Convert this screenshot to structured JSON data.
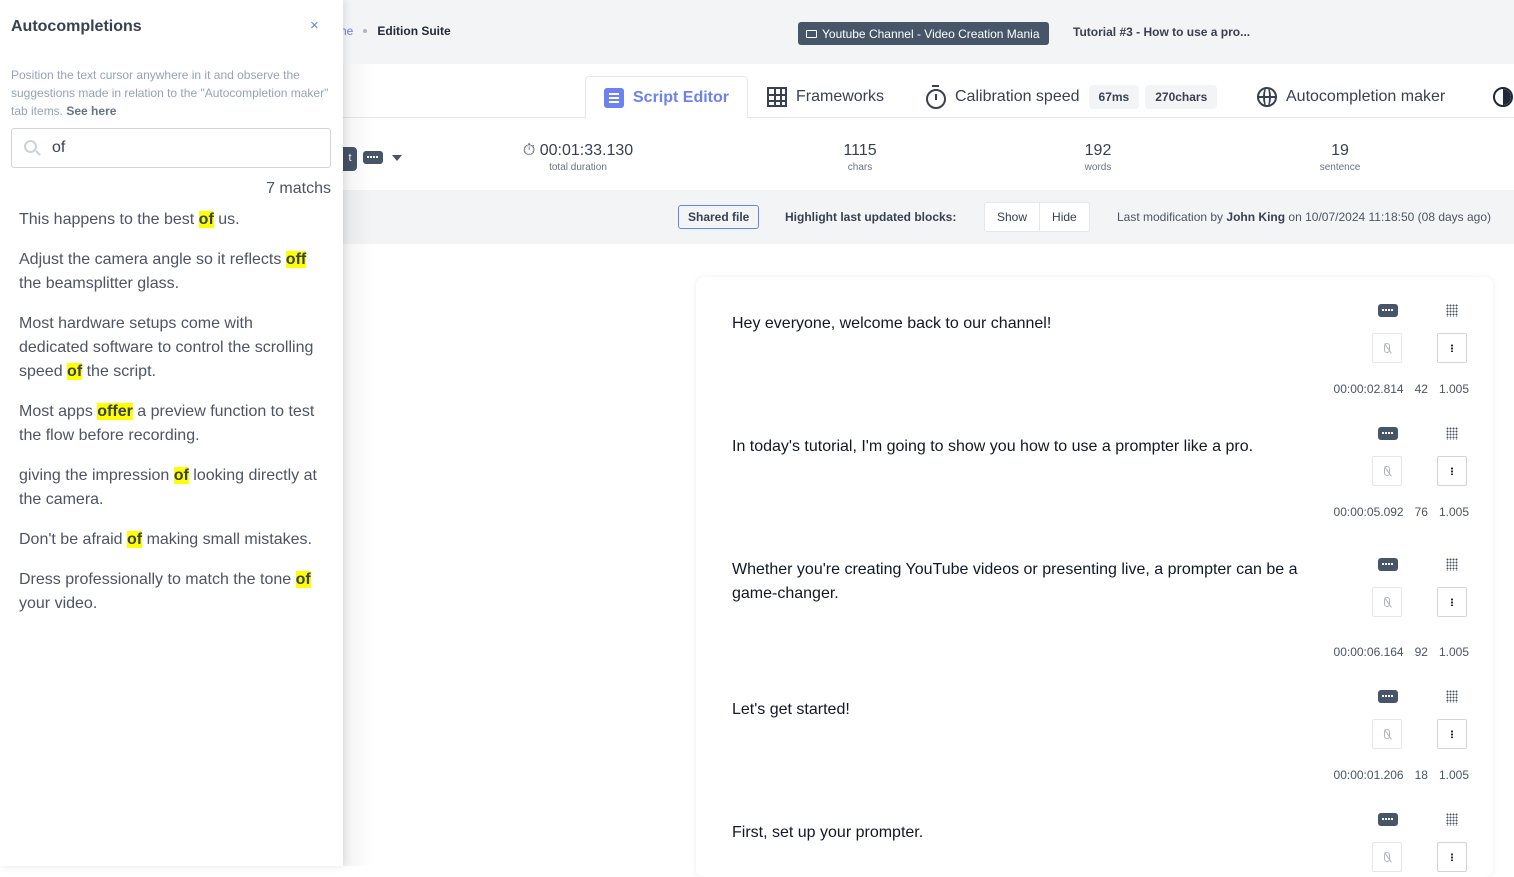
{
  "breadcrumb": {
    "previous": "ne",
    "current": "Edition Suite"
  },
  "project": {
    "name": "Youtube Channel - Video Creation Mania",
    "icon": "folder-icon"
  },
  "document_title": "Tutorial #3 - How to use a pro...",
  "tabs": [
    {
      "label": "Script Editor",
      "icon": "document-icon",
      "active": true
    },
    {
      "label": "Frameworks",
      "icon": "grid-icon"
    },
    {
      "label": "Calibration speed",
      "icon": "stopwatch-icon",
      "badges": [
        "67ms",
        "270chars"
      ]
    },
    {
      "label": "Autocompletion maker",
      "icon": "globe-icon"
    },
    {
      "label": "",
      "icon": "contrast-icon"
    }
  ],
  "stats": {
    "duration": {
      "value": "00:01:33.130",
      "label": "total duration"
    },
    "chars": {
      "value": "1115",
      "label": "chars"
    },
    "words": {
      "value": "192",
      "label": "words"
    },
    "sentences": {
      "value": "19",
      "label": "sentence"
    }
  },
  "toolbar": {
    "partial_button": "t"
  },
  "infobar": {
    "shared_label": "Shared file",
    "highlight_label": "Highlight last updated blocks:",
    "show_label": "Show",
    "hide_label": "Hide",
    "lastmod_prefix": "Last modification by",
    "lastmod_user": "John King",
    "lastmod_suffix": "on 10/07/2024 11:18:50 (08 days ago)"
  },
  "blocks": [
    {
      "text": "Hey everyone, welcome back to our channel!",
      "duration": "00:00:02.814",
      "chars": "42",
      "speed": "1.005"
    },
    {
      "text": "In today's tutorial, I'm going to show you how to use a prompter like a pro.",
      "duration": "00:00:05.092",
      "chars": "76",
      "speed": "1.005"
    },
    {
      "text": "Whether you're creating YouTube videos or presenting live, a prompter can be a game-changer.",
      "duration": "00:00:06.164",
      "chars": "92",
      "speed": "1.005"
    },
    {
      "text": "Let's get started!",
      "duration": "00:00:01.206",
      "chars": "18",
      "speed": "1.005"
    },
    {
      "text": "First, set up your prompter.",
      "duration": "",
      "chars": "",
      "speed": ""
    }
  ],
  "panel": {
    "title": "Autocompletions",
    "close": "×",
    "description": "Position the text cursor anywhere in it and observe the suggestions made in relation to the \"Autocompletion maker\" tab items.",
    "see_here": "See here",
    "search_value": "of",
    "match_count": "7 matchs",
    "suggestions": [
      {
        "before": "This happens to the best ",
        "match": "of",
        "after": " us."
      },
      {
        "before": "Adjust the camera angle so it reflects ",
        "match": "off",
        "after": " the beamsplitter glass."
      },
      {
        "before": "Most hardware setups come with dedicated software to control the scrolling speed ",
        "match": "of",
        "after": " the script."
      },
      {
        "before": "Most apps ",
        "match": "offer",
        "after": " a preview function to test the flow before recording."
      },
      {
        "before": "giving the impression ",
        "match": "of",
        "after": " looking directly at the camera."
      },
      {
        "before": "Don't be afraid ",
        "match": "of",
        "after": " making small mistakes."
      },
      {
        "before": "Dress professionally to match the tone ",
        "match": "of",
        "after": " your video."
      }
    ]
  },
  "colors": {
    "accent": "#6b82f0",
    "highlight": "#ffff00",
    "badge_dark": "#475569"
  }
}
